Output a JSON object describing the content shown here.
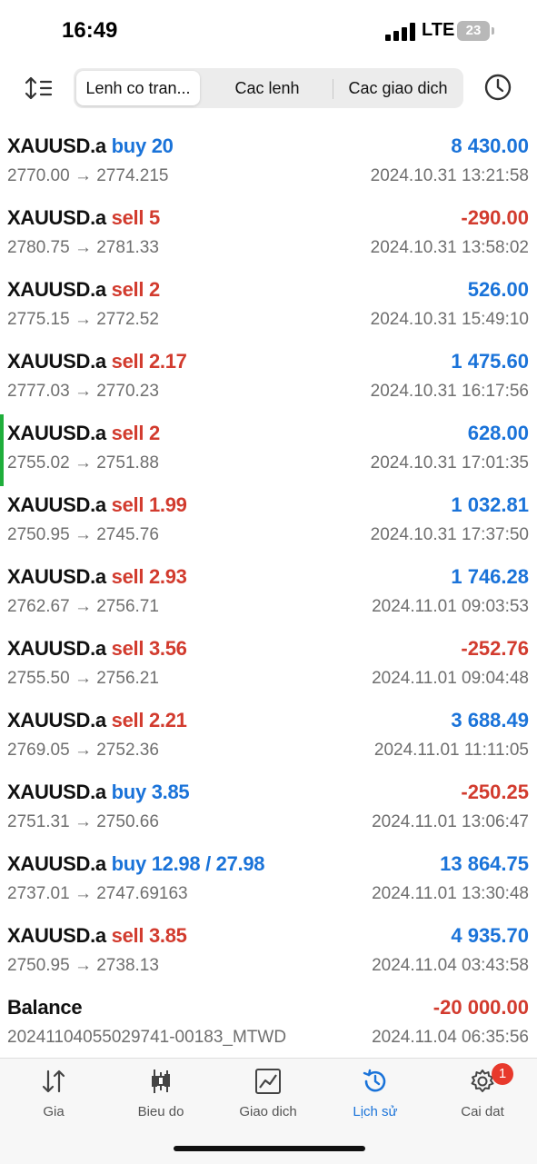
{
  "status_bar": {
    "time": "16:49",
    "network": "LTE",
    "battery": "23"
  },
  "toolbar": {
    "tabs": [
      {
        "label": "Lenh co tran...",
        "active": true
      },
      {
        "label": "Cac lenh",
        "active": false
      },
      {
        "label": "Cac giao dich",
        "active": false
      }
    ],
    "sort_icon": "sort-icon",
    "history_icon": "clock-icon"
  },
  "trades": [
    {
      "symbol": "XAUUSD.a",
      "side": "buy 20",
      "type": "buy",
      "prices": "2770.00 → 2774.215",
      "profit": "8 430.00",
      "sign": "pos",
      "time": "2024.10.31 13:21:58"
    },
    {
      "symbol": "XAUUSD.a",
      "side": "sell 5",
      "type": "sell",
      "prices": "2780.75 → 2781.33",
      "profit": "-290.00",
      "sign": "neg",
      "time": "2024.10.31 13:58:02"
    },
    {
      "symbol": "XAUUSD.a",
      "side": "sell 2",
      "type": "sell",
      "prices": "2775.15 → 2772.52",
      "profit": "526.00",
      "sign": "pos",
      "time": "2024.10.31 15:49:10"
    },
    {
      "symbol": "XAUUSD.a",
      "side": "sell 2.17",
      "type": "sell",
      "prices": "2777.03 → 2770.23",
      "profit": "1 475.60",
      "sign": "pos",
      "time": "2024.10.31 16:17:56"
    },
    {
      "symbol": "XAUUSD.a",
      "side": "sell 2",
      "type": "sell",
      "prices": "2755.02 → 2751.88",
      "profit": "628.00",
      "sign": "pos",
      "time": "2024.10.31 17:01:35",
      "marked": true
    },
    {
      "symbol": "XAUUSD.a",
      "side": "sell 1.99",
      "type": "sell",
      "prices": "2750.95 → 2745.76",
      "profit": "1 032.81",
      "sign": "pos",
      "time": "2024.10.31 17:37:50"
    },
    {
      "symbol": "XAUUSD.a",
      "side": "sell 2.93",
      "type": "sell",
      "prices": "2762.67 → 2756.71",
      "profit": "1 746.28",
      "sign": "pos",
      "time": "2024.11.01 09:03:53"
    },
    {
      "symbol": "XAUUSD.a",
      "side": "sell 3.56",
      "type": "sell",
      "prices": "2755.50 → 2756.21",
      "profit": "-252.76",
      "sign": "neg",
      "time": "2024.11.01 09:04:48"
    },
    {
      "symbol": "XAUUSD.a",
      "side": "sell 2.21",
      "type": "sell",
      "prices": "2769.05 → 2752.36",
      "profit": "3 688.49",
      "sign": "pos",
      "time": "2024.11.01 11:11:05"
    },
    {
      "symbol": "XAUUSD.a",
      "side": "buy 3.85",
      "type": "buy",
      "prices": "2751.31 → 2750.66",
      "profit": "-250.25",
      "sign": "neg",
      "time": "2024.11.01 13:06:47"
    },
    {
      "symbol": "XAUUSD.a",
      "side": "buy 12.98 / 27.98",
      "type": "buy",
      "prices": "2737.01 → 2747.69163",
      "profit": "13 864.75",
      "sign": "pos",
      "time": "2024.11.01 13:30:48"
    },
    {
      "symbol": "XAUUSD.a",
      "side": "sell 3.85",
      "type": "sell",
      "prices": "2750.95 → 2738.13",
      "profit": "4 935.70",
      "sign": "pos",
      "time": "2024.11.04 03:43:58"
    },
    {
      "symbol": "Balance",
      "side": "",
      "type": "none",
      "prices": "20241104055029741-00183_MTWD",
      "profit": "-20 000.00",
      "sign": "neg",
      "time": "2024.11.04 06:35:56"
    }
  ],
  "colors": {
    "buy": "#1a73d9",
    "sell": "#d23b2e",
    "marker": "#1fae3b"
  },
  "bottom_nav": [
    {
      "label": "Gia",
      "icon": "price-arrows-icon",
      "active": false
    },
    {
      "label": "Bieu do",
      "icon": "candlestick-icon",
      "active": false
    },
    {
      "label": "Giao dich",
      "icon": "chart-line-icon",
      "active": false
    },
    {
      "label": "Lịch sử",
      "icon": "history-icon",
      "active": true
    },
    {
      "label": "Cai dat",
      "icon": "gear-icon",
      "active": false,
      "badge": "1"
    }
  ]
}
